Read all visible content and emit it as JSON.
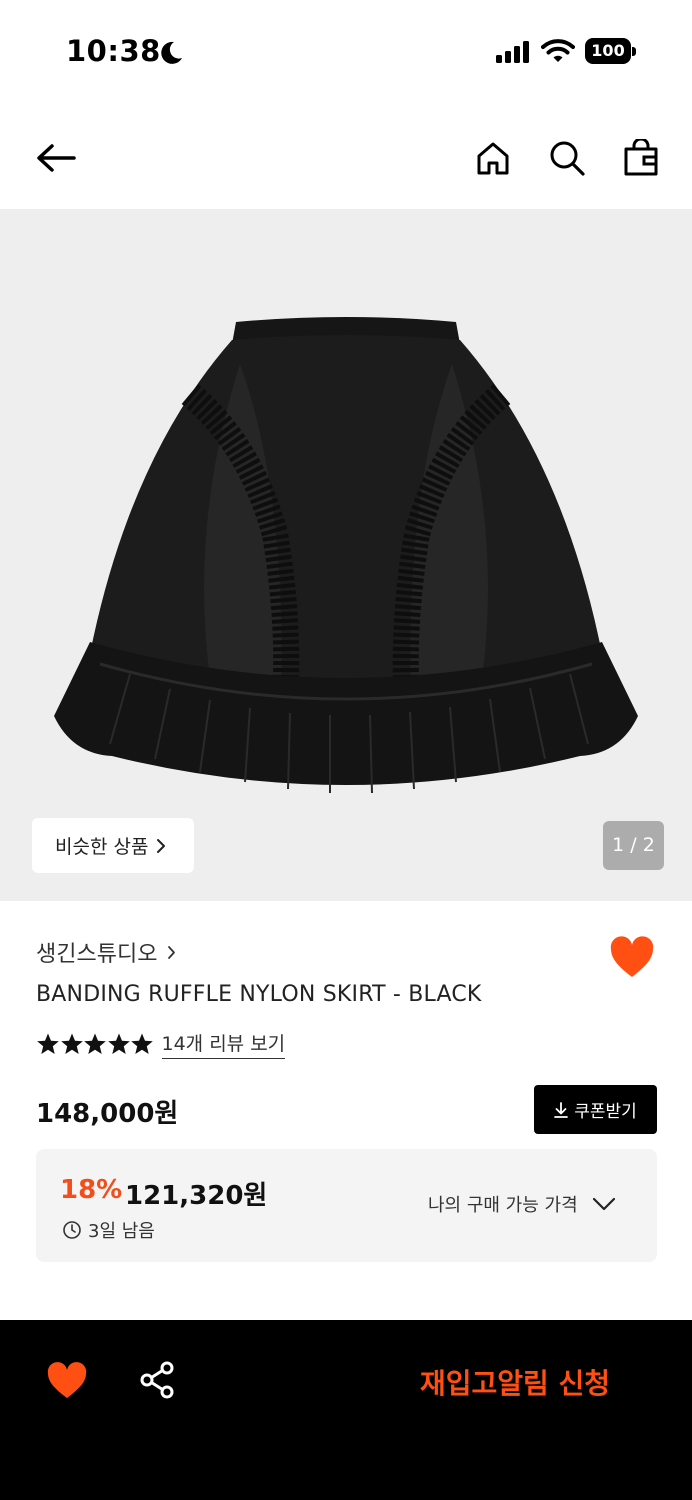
{
  "status_bar": {
    "time": "10:38",
    "battery": "100"
  },
  "header": {
    "icons": [
      "back-arrow-icon",
      "home-icon",
      "search-icon",
      "shopping-bag-icon"
    ]
  },
  "gallery": {
    "similar_label": "비슷한 상품",
    "page_indicator": "1 / 2"
  },
  "product": {
    "brand": "생긴스튜디오",
    "title": "BANDING RUFFLE NYLON SKIRT - BLACK",
    "rating_stars": 5,
    "review_link": "14개 리뷰 보기",
    "price": "148,000원",
    "coupon_label": "쿠폰받기",
    "discount_rate": "18%",
    "discount_price": "121,320원",
    "remaining": "3일 남음",
    "my_price_label": "나의 구매 가능 가격"
  },
  "bottom_bar": {
    "restock_label": "재입고알림 신청"
  },
  "colors": {
    "accent": "#ff4f13",
    "discount": "#f24d1a",
    "bottom_bar_bg": "#000000",
    "image_bg": "#eeeeef"
  }
}
